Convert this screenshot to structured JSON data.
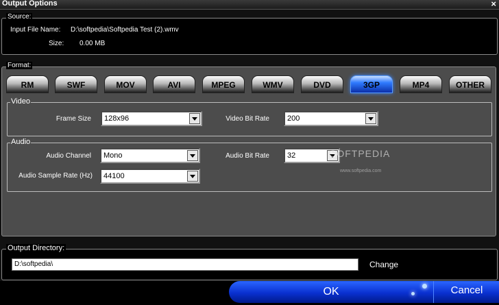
{
  "window": {
    "title": "Output Options",
    "close_symbol": "×"
  },
  "source": {
    "label": "Source:",
    "input_file_label": "Input File Name:",
    "input_file_value": "D:\\softpedia\\Softpedia Test (2).wmv",
    "size_label": "Size:",
    "size_value": "0.00 MB"
  },
  "format": {
    "label": "Format:",
    "tabs": [
      {
        "label": "RM"
      },
      {
        "label": "SWF"
      },
      {
        "label": "MOV"
      },
      {
        "label": "AVI"
      },
      {
        "label": "MPEG"
      },
      {
        "label": "WMV"
      },
      {
        "label": "DVD"
      },
      {
        "label": "3GP",
        "selected": true
      },
      {
        "label": "MP4"
      },
      {
        "label": "OTHER"
      }
    ],
    "watermark": "SOFTPEDIA",
    "watermark_url": "www.softpedia.com"
  },
  "video": {
    "label": "Video",
    "frame_size_label": "Frame Size",
    "frame_size_value": "128x96",
    "bit_rate_label": "Video Bit Rate",
    "bit_rate_value": "200"
  },
  "audio": {
    "label": "Audio",
    "channel_label": "Audio Channel",
    "channel_value": "Mono",
    "bit_rate_label": "Audio Bit Rate",
    "bit_rate_value": "32",
    "sample_rate_label": "Audio Sample Rate (Hz)",
    "sample_rate_value": "44100"
  },
  "output": {
    "label": "Output Directory:",
    "path": "D:\\softpedia\\",
    "change_label": "Change"
  },
  "buttons": {
    "ok": "OK",
    "cancel": "Cancel"
  },
  "colors": {
    "accent": "#0a30d0",
    "active_tab": "#2f7bff",
    "panel": "#4c4c4c"
  }
}
